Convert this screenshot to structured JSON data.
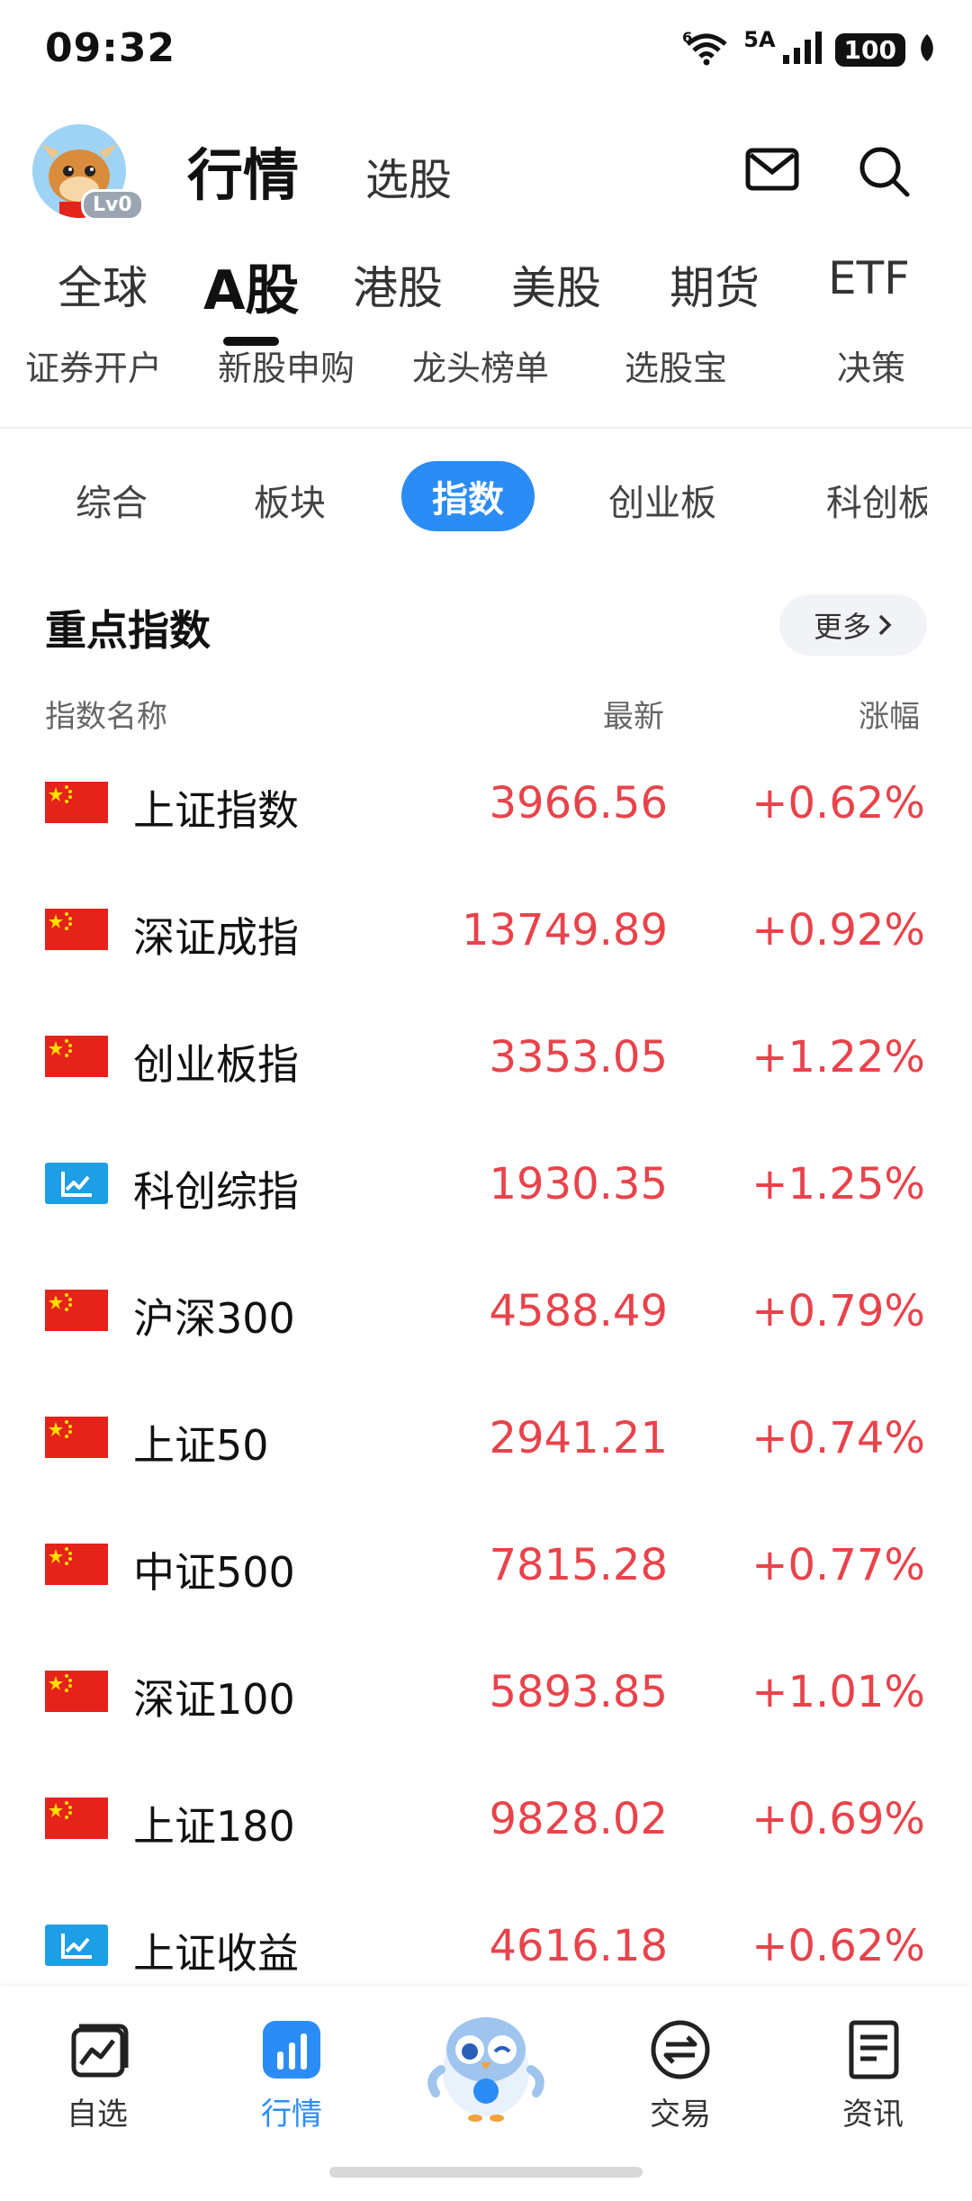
{
  "status_bar": {
    "time": "09:32",
    "wifi_label": "6",
    "signal_label": "5A",
    "battery": "100"
  },
  "header": {
    "avatar_level": "Lv0",
    "title": "行情",
    "subtitle": "选股"
  },
  "market_tabs": [
    {
      "label": "全球",
      "active": false
    },
    {
      "label": "A股",
      "active": true
    },
    {
      "label": "港股",
      "active": false
    },
    {
      "label": "美股",
      "active": false
    },
    {
      "label": "期货",
      "active": false
    },
    {
      "label": "ETF",
      "active": false
    }
  ],
  "sub_links": [
    "证券开户",
    "新股申购",
    "龙头榜单",
    "选股宝",
    "决策"
  ],
  "category_tabs": [
    {
      "label": "综合",
      "active": false
    },
    {
      "label": "板块",
      "active": false
    },
    {
      "label": "指数",
      "active": true
    },
    {
      "label": "创业板",
      "active": false
    },
    {
      "label": "科创板",
      "active": false
    }
  ],
  "section": {
    "title": "重点指数",
    "more_label": "更多",
    "col_name": "指数名称",
    "col_latest": "最新",
    "col_change": "涨幅"
  },
  "indices": [
    {
      "flag": "cn-flag-icon",
      "name": "上证指数",
      "latest": "3966.56",
      "change": "+0.62%"
    },
    {
      "flag": "cn-flag-icon",
      "name": "深证成指",
      "latest": "13749.89",
      "change": "+0.92%"
    },
    {
      "flag": "cn-flag-icon",
      "name": "创业板指",
      "latest": "3353.05",
      "change": "+1.22%"
    },
    {
      "flag": "chart-icon",
      "name": "科创综指",
      "latest": "1930.35",
      "change": "+1.25%"
    },
    {
      "flag": "cn-flag-icon",
      "name": "沪深300",
      "latest": "4588.49",
      "change": "+0.79%"
    },
    {
      "flag": "cn-flag-icon",
      "name": "上证50",
      "latest": "2941.21",
      "change": "+0.74%"
    },
    {
      "flag": "cn-flag-icon",
      "name": "中证500",
      "latest": "7815.28",
      "change": "+0.77%"
    },
    {
      "flag": "cn-flag-icon",
      "name": "深证100",
      "latest": "5893.85",
      "change": "+1.01%"
    },
    {
      "flag": "cn-flag-icon",
      "name": "上证180",
      "latest": "9828.02",
      "change": "+0.69%"
    },
    {
      "flag": "chart-icon",
      "name": "上证收益",
      "latest": "4616.18",
      "change": "+0.62%"
    }
  ],
  "bottom_nav": [
    {
      "label": "自选",
      "icon": "watchlist-icon",
      "active": false
    },
    {
      "label": "行情",
      "icon": "market-icon",
      "active": true
    },
    {
      "label": "",
      "icon": "mascot-icon",
      "active": false
    },
    {
      "label": "交易",
      "icon": "trade-icon",
      "active": false
    },
    {
      "label": "资讯",
      "icon": "news-icon",
      "active": false
    }
  ],
  "colors": {
    "accent": "#2b8cf5",
    "up": "#e8434b",
    "flag_red": "#e5231b",
    "flag_star": "#ffde00",
    "chart_blue": "#1e9ee5"
  }
}
